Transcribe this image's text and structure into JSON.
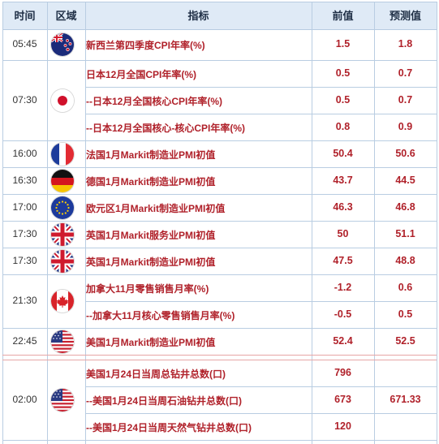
{
  "header": {
    "time": "时间",
    "region": "区域",
    "indicator": "指标",
    "previous": "前值",
    "forecast": "预测值"
  },
  "events": [
    {
      "time": "05:45",
      "flag": "new-zealand",
      "rows": [
        {
          "indicator": "新西兰第四季度CPI年率(%)",
          "previous": "1.5",
          "forecast": "1.8"
        }
      ]
    },
    {
      "time": "07:30",
      "flag": "japan",
      "rows": [
        {
          "indicator": "日本12月全国CPI年率(%)",
          "previous": "0.5",
          "forecast": "0.7"
        },
        {
          "indicator": "--日本12月全国核心CPI年率(%)",
          "previous": "0.5",
          "forecast": "0.7"
        },
        {
          "indicator": "--日本12月全国核心-核心CPI年率(%)",
          "previous": "0.8",
          "forecast": "0.9"
        }
      ]
    },
    {
      "time": "16:00",
      "flag": "france",
      "rows": [
        {
          "indicator": "法国1月Markit制造业PMI初值",
          "previous": "50.4",
          "forecast": "50.6"
        }
      ]
    },
    {
      "time": "16:30",
      "flag": "germany",
      "rows": [
        {
          "indicator": "德国1月Markit制造业PMI初值",
          "previous": "43.7",
          "forecast": "44.5"
        }
      ]
    },
    {
      "time": "17:00",
      "flag": "eurozone",
      "rows": [
        {
          "indicator": "欧元区1月Markit制造业PMI初值",
          "previous": "46.3",
          "forecast": "46.8"
        }
      ]
    },
    {
      "time": "17:30",
      "flag": "united-kingdom",
      "rows": [
        {
          "indicator": "英国1月Markit服务业PMI初值",
          "previous": "50",
          "forecast": "51.1"
        }
      ]
    },
    {
      "time": "17:30",
      "flag": "united-kingdom",
      "rows": [
        {
          "indicator": "英国1月Markit制造业PMI初值",
          "previous": "47.5",
          "forecast": "48.8"
        }
      ]
    },
    {
      "time": "21:30",
      "flag": "canada",
      "rows": [
        {
          "indicator": "加拿大11月零售销售月率(%)",
          "previous": "-1.2",
          "forecast": "0.6"
        },
        {
          "indicator": "--加拿大11月核心零售销售月率(%)",
          "previous": "-0.5",
          "forecast": "0.5"
        }
      ]
    },
    {
      "time": "22:45",
      "flag": "united-states",
      "rows": [
        {
          "indicator": "美国1月Markit制造业PMI初值",
          "previous": "52.4",
          "forecast": "52.5"
        }
      ]
    },
    {
      "time": "02:00",
      "flag": "united-states",
      "rows": [
        {
          "indicator": "美国1月24日当周总钻井总数(口)",
          "previous": "796",
          "forecast": ""
        },
        {
          "indicator": "--美国1月24日当周石油钻井总数(口)",
          "previous": "673",
          "forecast": "671.33"
        },
        {
          "indicator": "--美国1月24日当周天然气钻井总数(口)",
          "previous": "120",
          "forecast": ""
        }
      ]
    }
  ],
  "colors": {
    "header_bg": "#dfeaf6",
    "grid": "#b9cde2",
    "day_separator": "#e6a6a6",
    "text_red": "#b0212a"
  }
}
